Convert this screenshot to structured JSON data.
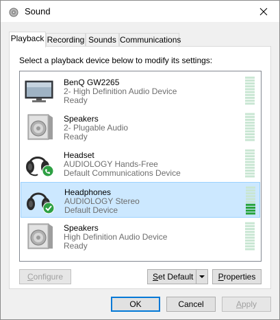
{
  "window": {
    "title": "Sound"
  },
  "tabs": [
    {
      "label": "Playback",
      "active": true
    },
    {
      "label": "Recording",
      "active": false
    },
    {
      "label": "Sounds",
      "active": false
    },
    {
      "label": "Communications",
      "active": false
    }
  ],
  "instruction": "Select a playback device below to modify its settings:",
  "devices": [
    {
      "icon": "monitor-icon",
      "name": "BenQ GW2265",
      "subtitle": "2- High Definition Audio Device",
      "status": "Ready",
      "selected": false,
      "badge": null,
      "level": 0
    },
    {
      "icon": "speaker-icon",
      "name": "Speakers",
      "subtitle": "2- Plugable Audio",
      "status": "Ready",
      "selected": false,
      "badge": null,
      "level": 0
    },
    {
      "icon": "headset-icon",
      "name": "Headset",
      "subtitle": "AUDIOLOGY Hands-Free",
      "status": "Default Communications Device",
      "selected": false,
      "badge": "phone",
      "level": 0
    },
    {
      "icon": "headphones-icon",
      "name": "Headphones",
      "subtitle": "AUDIOLOGY Stereo",
      "status": "Default Device",
      "selected": true,
      "badge": "check",
      "level": 0.4
    },
    {
      "icon": "speaker-icon",
      "name": "Speakers",
      "subtitle": "High Definition Audio Device",
      "status": "Ready",
      "selected": false,
      "badge": null,
      "level": 0
    }
  ],
  "buttons": {
    "configure": "Configure",
    "set_default": "Set Default",
    "properties": "Properties",
    "ok": "OK",
    "cancel": "Cancel",
    "apply": "Apply"
  },
  "colors": {
    "selection_bg": "#cce8ff",
    "selection_border": "#99d1ff",
    "meter_empty": "#c9e6d3",
    "meter_full": "#26a33b",
    "badge_green": "#2ea043",
    "default_button_border": "#0078d7"
  }
}
